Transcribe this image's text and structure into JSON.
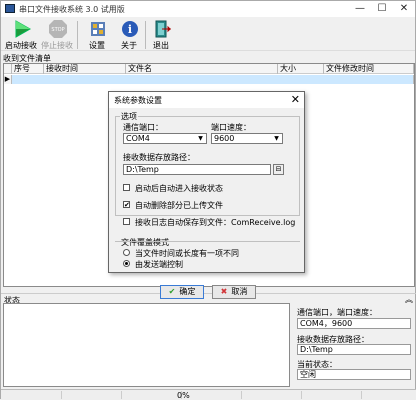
{
  "window": {
    "title": "串口文件接收系统 3.0 试用版"
  },
  "toolbar": {
    "start": "启动接收",
    "stop": "停止接收",
    "settings": "设置",
    "about": "关于",
    "exit": "退出"
  },
  "file_list": {
    "title": "收到文件清单",
    "columns": [
      "序号",
      "接收时间",
      "文件名",
      "大小",
      "文件修改时间"
    ],
    "row_marker": "▶"
  },
  "status": {
    "label": "状态",
    "port_label": "通信端口，端口速度：",
    "port_value": "COM4，9600",
    "path_label": "接收数据存放路径：",
    "path_value": "D:\\Temp",
    "state_label": "当前状态：",
    "state_value": "空闲",
    "progress_text": "0%",
    "progress_value": 0
  },
  "dialog": {
    "title": "系统参数设置",
    "close": "✕",
    "options_group": "选项",
    "port_label": "通信端口：",
    "port_value": "COM4",
    "speed_label": "端口速度：",
    "speed_value": "9600",
    "path_label": "接收数据存放路径：",
    "path_value": "D:\\Temp",
    "chk_auto_start": "启动后自动进入接收状态",
    "chk_auto_delete": "自动删除部分已上传文件",
    "chk_log": "接收日志自动保存到文件：ComReceive.log",
    "checked_mark": "✔",
    "overwrite_group": "文件覆盖模式",
    "radio_time_size": "当文件时间或长度有一项不同",
    "radio_sender": "由发送端控制",
    "ok": "确定",
    "cancel": "取消"
  },
  "colors": {
    "selection": "#cce8ff",
    "ok_icon": "#2e9d2e",
    "cancel_icon": "#d13438"
  }
}
